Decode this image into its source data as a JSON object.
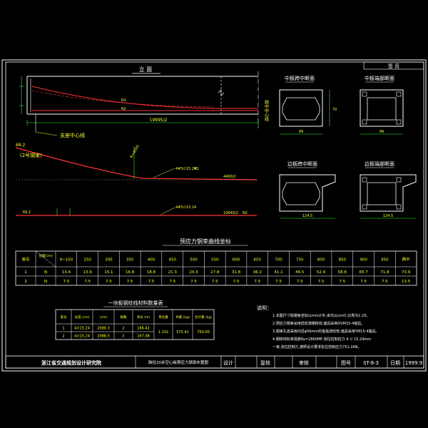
{
  "sheet": {
    "corner_label": "签    页",
    "elevation_title": "立    面",
    "dim_total": "19995/2",
    "span_center": "跨中中心线",
    "center_line": "支座中心线",
    "beam_end_label": "(2号钢束)",
    "cable_labels": [
      "N1",
      "N2"
    ],
    "elev_detail_values": [
      "68.2",
      "2.5",
      "R=4000",
      "4#5∅15.24",
      "4400/2",
      "N1",
      "69.2",
      "4#5∅15.24",
      "10640/2",
      "N2"
    ]
  },
  "sections": [
    {
      "title": "中板跨中断面",
      "width_dim": "99",
      "height_dim": "70"
    },
    {
      "title": "中板端部断面",
      "width_dim": "99",
      "height_dim": "70"
    },
    {
      "title": "边板跨中断面",
      "width_dim": "124.5",
      "height_dim": "70"
    },
    {
      "title": "边板端部断面",
      "width_dim": "124.5",
      "height_dim": "70"
    }
  ],
  "coord_table": {
    "title": "预应力钢束曲线坐标",
    "headers": [
      "束号",
      "x/y",
      "0~150",
      "250",
      "300",
      "350",
      "400",
      "450",
      "500",
      "550",
      "600",
      "650",
      "700",
      "750",
      "800",
      "850",
      "900",
      "950",
      "跨中"
    ],
    "header_note": "位置(cm)",
    "rows": [
      [
        "1",
        "N",
        "13.4",
        "13.9",
        "15.1",
        "16.8",
        "18.8",
        "21.3",
        "24.3",
        "27.8",
        "31.8",
        "36.2",
        "41.1",
        "46.5",
        "52.4",
        "58.8",
        "65.7",
        "71.8",
        "73.9"
      ],
      [
        "2",
        "N",
        "7.5",
        "7.5",
        "7.5",
        "7.5",
        "7.5",
        "7.5",
        "7.5",
        "7.5",
        "7.5",
        "7.5",
        "7.5",
        "7.5",
        "7.5",
        "7.5",
        "7.5",
        "7.5",
        "13.5"
      ]
    ]
  },
  "steel_table": {
    "title": "一块板钢绞线材料数量表",
    "headers": [
      "束号",
      "长度 (cm)",
      "(cm)",
      "根数",
      "共长 (m)",
      "单位重",
      "共重 (kg)",
      "合计重 (kg)"
    ],
    "rows": [
      [
        "1",
        "4∅15.24",
        "2080.3",
        "2",
        "166.42",
        "1.102",
        "575.41",
        "750.00"
      ],
      [
        "2",
        "4∅15.24",
        "2088.5",
        "2",
        "167.08",
        "",
        "",
        ""
      ]
    ]
  },
  "notes": {
    "label": "说明：",
    "items": [
      "1.本图尺寸除钢束坐标以mm计外,余均以cm计,比例为1:25。",
      "2.预应力钢束采用低松弛钢绞线,锚具采用OVM15-4锚具。",
      "3.钢束孔道采用内径φ56mm的金属波纹管,锚具采用YM15-4锚具。",
      "4.钢绞线标准强度Ry=1860MP,张拉控制应力    4 ∅ 15.24mm",
      "一束,张拉控制力,按照设计要求张拉控制应力751.2KN。"
    ]
  },
  "title_block": {
    "institute": "浙江省交通规划设计研究院",
    "drawing_title": "跨径20米空心板预应力钢束布置图",
    "designed": "设计",
    "checked": "复核",
    "reviewed": "审核",
    "drawing_no_label": "图号",
    "drawing_no": "ST-8-3",
    "date_label": "日期",
    "date": "1999.9"
  },
  "colors": {
    "background": "#000000",
    "frame": "#ffffff",
    "tendon": "#ff3333",
    "dimension": "#33ff33",
    "text": "#ffff33",
    "accent": "#33ffff"
  }
}
